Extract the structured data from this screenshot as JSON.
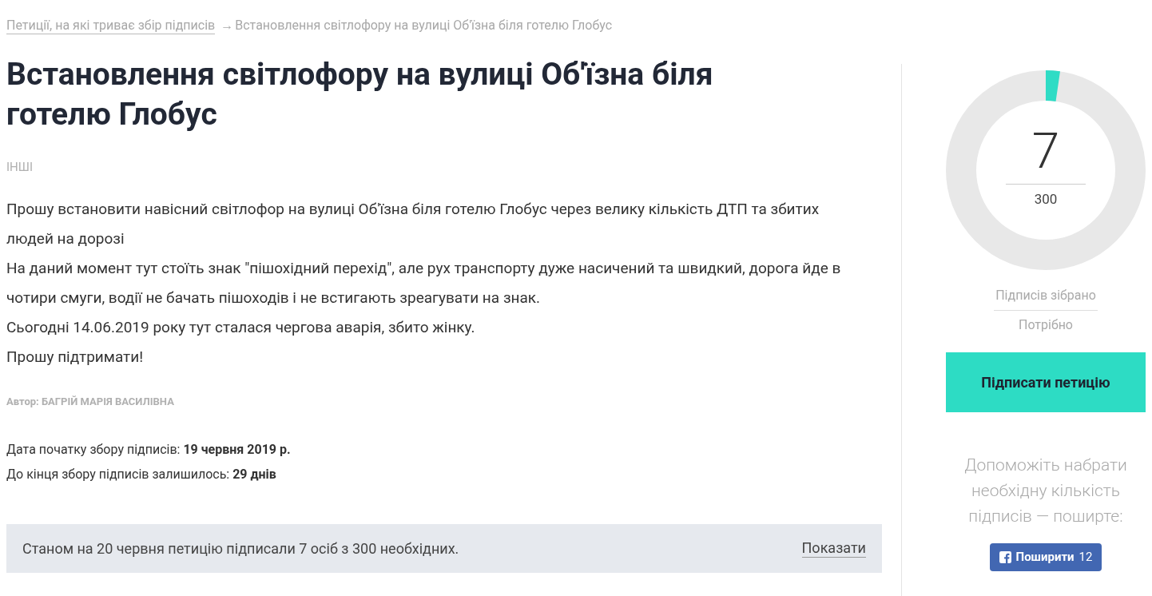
{
  "breadcrumb": {
    "link": "Петиції, на які триває збір підписів",
    "arrow": "→",
    "current": "Встановлення світлофору на вулиці Об'їзна біля готелю Глобус"
  },
  "title": "Встановлення світлофору на вулиці Об'їзна біля готелю Глобус",
  "category": "ІНШІ",
  "body": [
    "Прошу встановити навісний світлофор на вулиці Об'їзна біля готелю Глобус через велику кількість ДТП та збитих людей на дорозі",
    "На даний момент тут стоїть знак \"пішохідний перехід\", але рух транспорту дуже насичений та швидкий, дорога йде в чотири смуги, водії не бачать пішоходів і не встигають зреагувати на знак.",
    "Сьогодні 14.06.2019 року тут сталася чергова аварія, збито жінку.",
    "Прошу підтримати!"
  ],
  "author": "Автор: БАГРІЙ МАРІЯ ВАСИЛІВНА",
  "dates": [
    "Дата початку збору підписів: **19 червня 2019 р.**",
    "До кінця збору підписів залишилось: **29 днів**"
  ],
  "status_bar": {
    "text": "Станом на 20 червня петицію підписали 7 осіб з 300 необхідних.",
    "link": "Показати"
  },
  "progress": {
    "collected": "7",
    "required": "300",
    "collected_label": "Підписів зібрано",
    "required_label": "Потрібно"
  },
  "sign_button": "Підписати петицію",
  "share_prompt": "Допоможіть набрати необхідну кількість підписів — поширте:",
  "share_button": {
    "label": "Поширити",
    "count": "12"
  }
}
